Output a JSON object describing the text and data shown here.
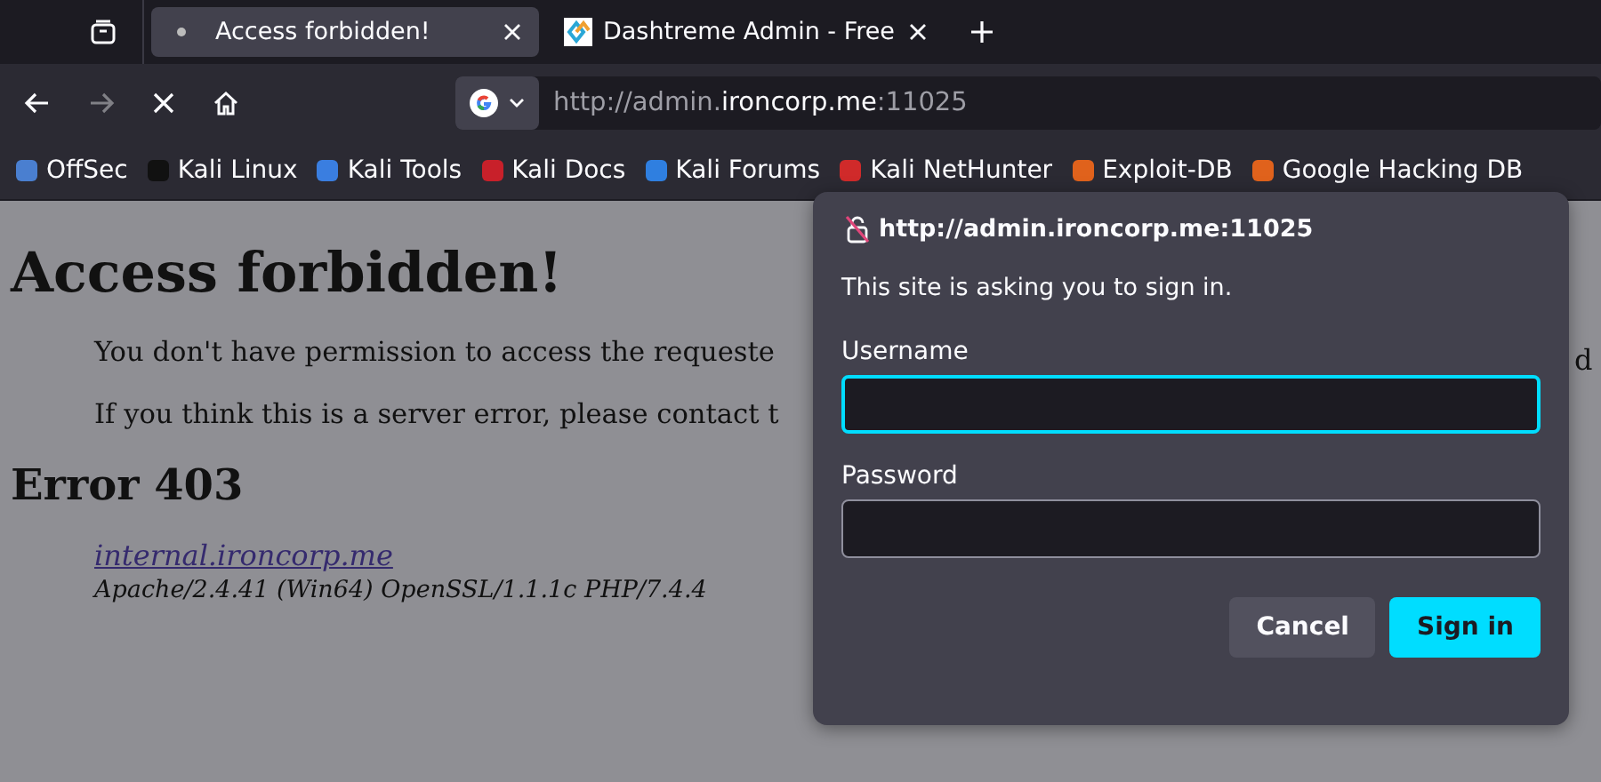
{
  "tabs": [
    {
      "label": "Access forbidden!",
      "selected": true,
      "kind": "loading"
    },
    {
      "label": "Dashtreme Admin - Free",
      "selected": false,
      "kind": "favicon"
    }
  ],
  "address_bar": {
    "url_parts": [
      {
        "text": "http://admin.",
        "emphasized": false
      },
      {
        "text": "ironcorp.me",
        "emphasized": true
      },
      {
        "text": ":11025",
        "emphasized": false
      }
    ]
  },
  "bookmarks": [
    {
      "label": "OffSec",
      "color": "#4a7fd0"
    },
    {
      "label": "Kali Linux",
      "color": "#111111"
    },
    {
      "label": "Kali Tools",
      "color": "#3a7ee0"
    },
    {
      "label": "Kali Docs",
      "color": "#c8202a"
    },
    {
      "label": "Kali Forums",
      "color": "#2f7fe0"
    },
    {
      "label": "Kali NetHunter",
      "color": "#d02a2a"
    },
    {
      "label": "Exploit-DB",
      "color": "#e0621c"
    },
    {
      "label": "Google Hacking DB",
      "color": "#e0621c"
    }
  ],
  "page": {
    "heading": "Access forbidden!",
    "paragraphs": [
      "You don't have permission to access the requeste",
      "If you think this is a server error, please contact t"
    ],
    "right_fragment": "d",
    "error_heading": "Error 403",
    "link": "internal.ironcorp.me",
    "server_info": "Apache/2.4.41 (Win64) OpenSSL/1.1.1c PHP/7.4.4"
  },
  "dialog": {
    "origin": "http://admin.ironcorp.me:11025",
    "message": "This site is asking you to sign in.",
    "fields": [
      {
        "label": "Username",
        "focused": true
      },
      {
        "label": "Password",
        "focused": false
      }
    ],
    "buttons": [
      {
        "label": "Cancel",
        "primary": false
      },
      {
        "label": "Sign in",
        "primary": true
      }
    ]
  }
}
